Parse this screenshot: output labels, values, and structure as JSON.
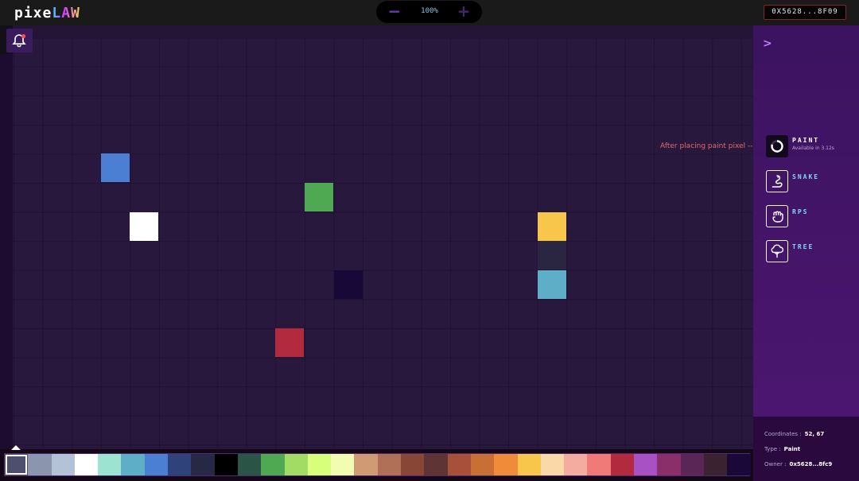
{
  "header": {
    "logo_left": "pixe",
    "logo_right": "LAW",
    "zoom": {
      "minus": "−",
      "value": "100%",
      "plus": "+"
    },
    "wallet": "0X5628...8F09"
  },
  "canvas": {
    "hint": "After placing paint pixel -->",
    "pixels": [
      {
        "col": 3,
        "row": 4,
        "color": "#4a7fd4"
      },
      {
        "col": 10,
        "row": 5,
        "color": "#4fa953"
      },
      {
        "col": 4,
        "row": 6,
        "color": "#ffffff"
      },
      {
        "col": 18,
        "row": 6,
        "color": "#f7c64a"
      },
      {
        "col": 18,
        "row": 7,
        "color": "#2a2540"
      },
      {
        "col": 11,
        "row": 8,
        "color": "#170838"
      },
      {
        "col": 18,
        "row": 8,
        "color": "#5eaec8"
      },
      {
        "col": 9,
        "row": 10,
        "color": "#b22a3e"
      }
    ]
  },
  "sidebar": {
    "toggle": ">",
    "apps": [
      {
        "name": "PAINT",
        "sub": "Available in 3.12s",
        "icon": "paint-spinner-icon",
        "active": true
      },
      {
        "name": "SNAKE",
        "sub": "",
        "icon": "snake-icon",
        "active": false
      },
      {
        "name": "RPS",
        "sub": "",
        "icon": "fist-icon",
        "active": false
      },
      {
        "name": "TREE",
        "sub": "",
        "icon": "tree-icon",
        "active": false
      }
    ]
  },
  "info": {
    "coordinates_label": "Coordinates :",
    "coordinates_value": "52, 67",
    "type_label": "Type :",
    "type_value": "Paint",
    "owner_label": "Owner :",
    "owner_value": "0x5628...8fc9"
  },
  "palette": {
    "selected_index": 0,
    "colors": [
      "#4e4f6e",
      "#8b96ae",
      "#b4c2d8",
      "#ffffff",
      "#9ce3d1",
      "#5eaec8",
      "#4a7fd4",
      "#2f437a",
      "#262845",
      "#000000",
      "#2a5446",
      "#4fa953",
      "#a2dc65",
      "#d8ff7c",
      "#f2fdb2",
      "#d09a74",
      "#b07058",
      "#884636",
      "#5e3434",
      "#a8503a",
      "#c86f33",
      "#f08b3a",
      "#f7c64a",
      "#fad8a8",
      "#f5aca0",
      "#ef7a78",
      "#b22a3e",
      "#a851c4",
      "#8b2f6a",
      "#5a2656",
      "#3a2230",
      "#190838"
    ]
  }
}
